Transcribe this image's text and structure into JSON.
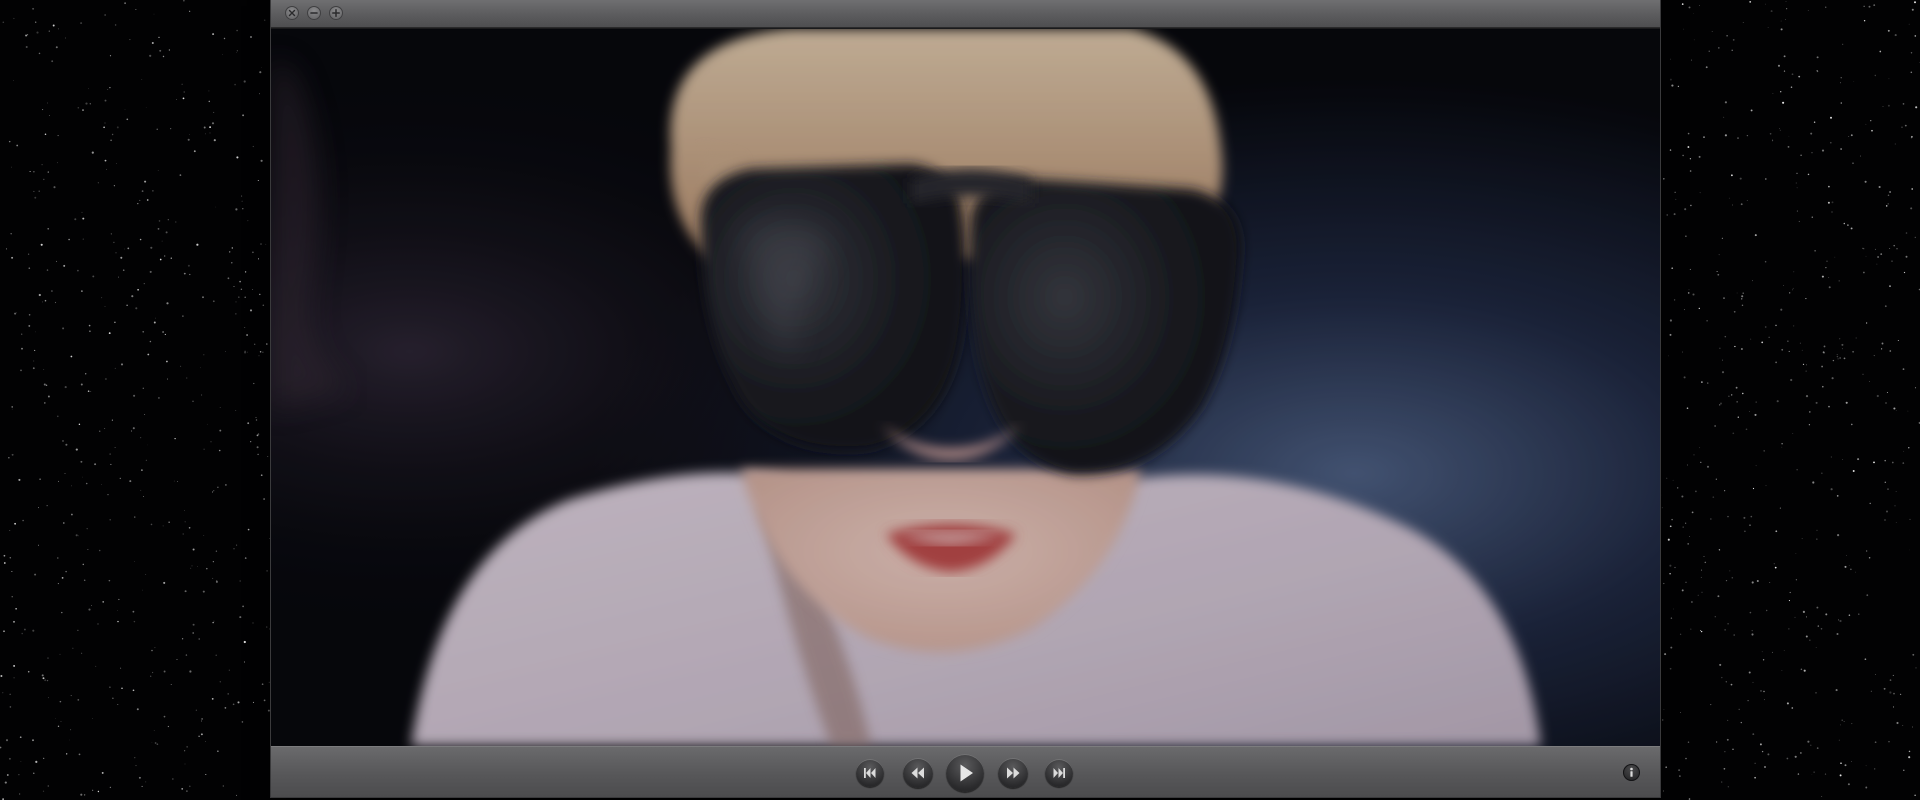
{
  "window": {
    "title": "",
    "buttons": [
      {
        "name": "close",
        "icon": "close-icon"
      },
      {
        "name": "minimize",
        "icon": "minimize-icon"
      },
      {
        "name": "zoom",
        "icon": "zoom-icon"
      }
    ]
  },
  "video": {
    "content": "video-frame",
    "state": "paused"
  },
  "controller": {
    "buttons": [
      {
        "name": "skip-back",
        "icon": "skip-back-icon"
      },
      {
        "name": "rewind",
        "icon": "rewind-icon"
      },
      {
        "name": "play",
        "icon": "play-icon"
      },
      {
        "name": "fast-forward",
        "icon": "fast-forward-icon"
      },
      {
        "name": "skip-forward",
        "icon": "skip-forward-icon"
      }
    ],
    "info_icon": "info-icon"
  },
  "colors": {
    "desktop_background": "#020203",
    "chrome_top": "#6f6f71",
    "chrome_bottom": "#4c4c4e",
    "button_dark": "#2b2b2d",
    "glyph": "#dcdcdc"
  }
}
